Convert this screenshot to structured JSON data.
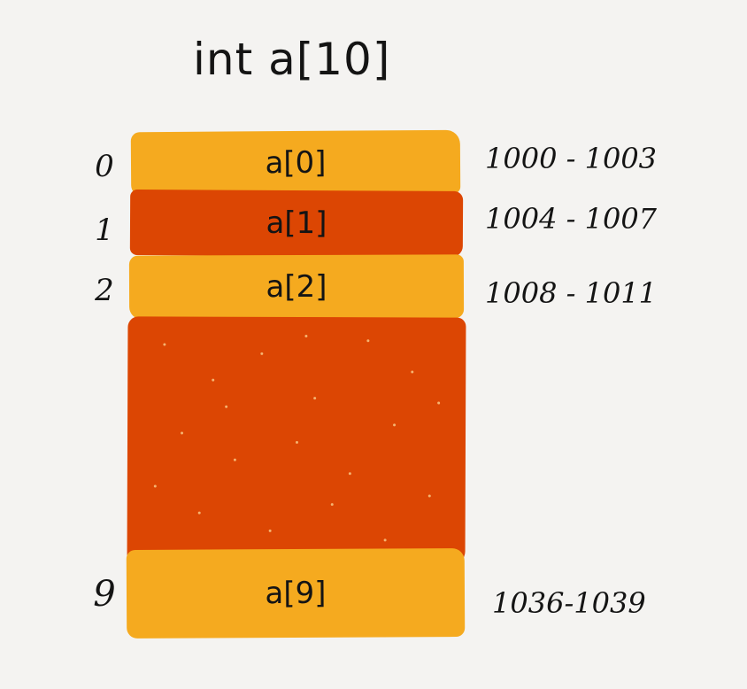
{
  "title": "int a[10]",
  "colors": {
    "background": "#f4f3f1",
    "light_block": "#f5aa1f",
    "dark_block": "#dc4603",
    "ink": "#141414"
  },
  "rows": [
    {
      "index": "0",
      "label": "a[0]",
      "address": "1000 - 1003"
    },
    {
      "index": "1",
      "label": "a[1]",
      "address": "1004 - 1007"
    },
    {
      "index": "2",
      "label": "a[2]",
      "address": "1008 - 1011"
    },
    {
      "index": "9",
      "label": "a[9]",
      "address": "1036-1039"
    }
  ]
}
